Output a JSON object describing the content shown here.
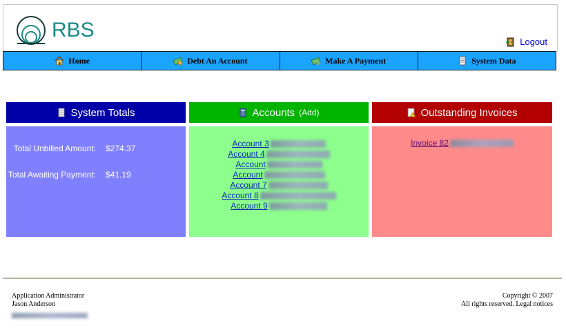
{
  "header": {
    "logo_text": "RBS",
    "logout_label": "Logout"
  },
  "nav": {
    "items": [
      {
        "label": "Home",
        "icon": "house-icon"
      },
      {
        "label": "Debt An Account",
        "icon": "money-icon"
      },
      {
        "label": "Make A Payment",
        "icon": "money-plus-icon"
      },
      {
        "label": "System Data",
        "icon": "document-icon"
      }
    ]
  },
  "panels": {
    "totals": {
      "title": "System Totals",
      "rows": [
        {
          "label": "Total Unbilled Amount:",
          "value": "$274.37"
        },
        {
          "label": "Total Awaiting Payment:",
          "value": "$41.19"
        }
      ]
    },
    "accounts": {
      "title": "Accounts",
      "add_label": "(Add)",
      "items": [
        "Account 3",
        "Account 4",
        "Account",
        "Account",
        "Account 7",
        "Account 8",
        "Account 9"
      ]
    },
    "invoices": {
      "title": "Outstanding Invoices",
      "items": [
        "Invoice 82"
      ]
    }
  },
  "colors": {
    "nav_bg": "#1aa3ff",
    "totals_head": "#0000a8",
    "totals_body": "#8080ff",
    "accounts_head": "#00b400",
    "accounts_body": "#8cff8c",
    "invoices_head": "#b30000",
    "invoices_body": "#ff8a8a",
    "logo": "#1a8a86"
  },
  "footer": {
    "left_line1": "Application Administrator",
    "left_line2": "Jason Anderson",
    "right_line1": "Copyright © 2007",
    "right_line2": "All rights reserved. Legal notices"
  }
}
